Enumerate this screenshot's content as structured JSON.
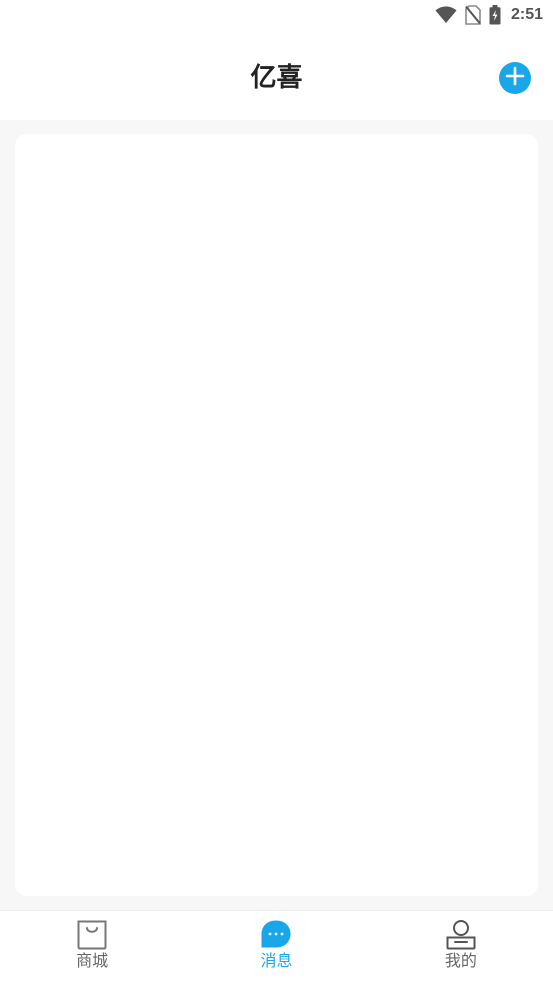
{
  "status_bar": {
    "time": "2:51",
    "icons": [
      "wifi-icon",
      "no-sim-icon",
      "battery-charging-icon"
    ]
  },
  "header": {
    "title": "亿喜",
    "add_icon": "plus-icon"
  },
  "bottom_nav": {
    "items": [
      {
        "label": "商城",
        "icon": "shopping-bag-icon",
        "active": false
      },
      {
        "label": "消息",
        "icon": "chat-bubble-icon",
        "active": true
      },
      {
        "label": "我的",
        "icon": "profile-icon",
        "active": false
      }
    ]
  },
  "colors": {
    "accent": "#1aa7ea",
    "background": "#f7f7f7",
    "inactive": "#666666"
  }
}
